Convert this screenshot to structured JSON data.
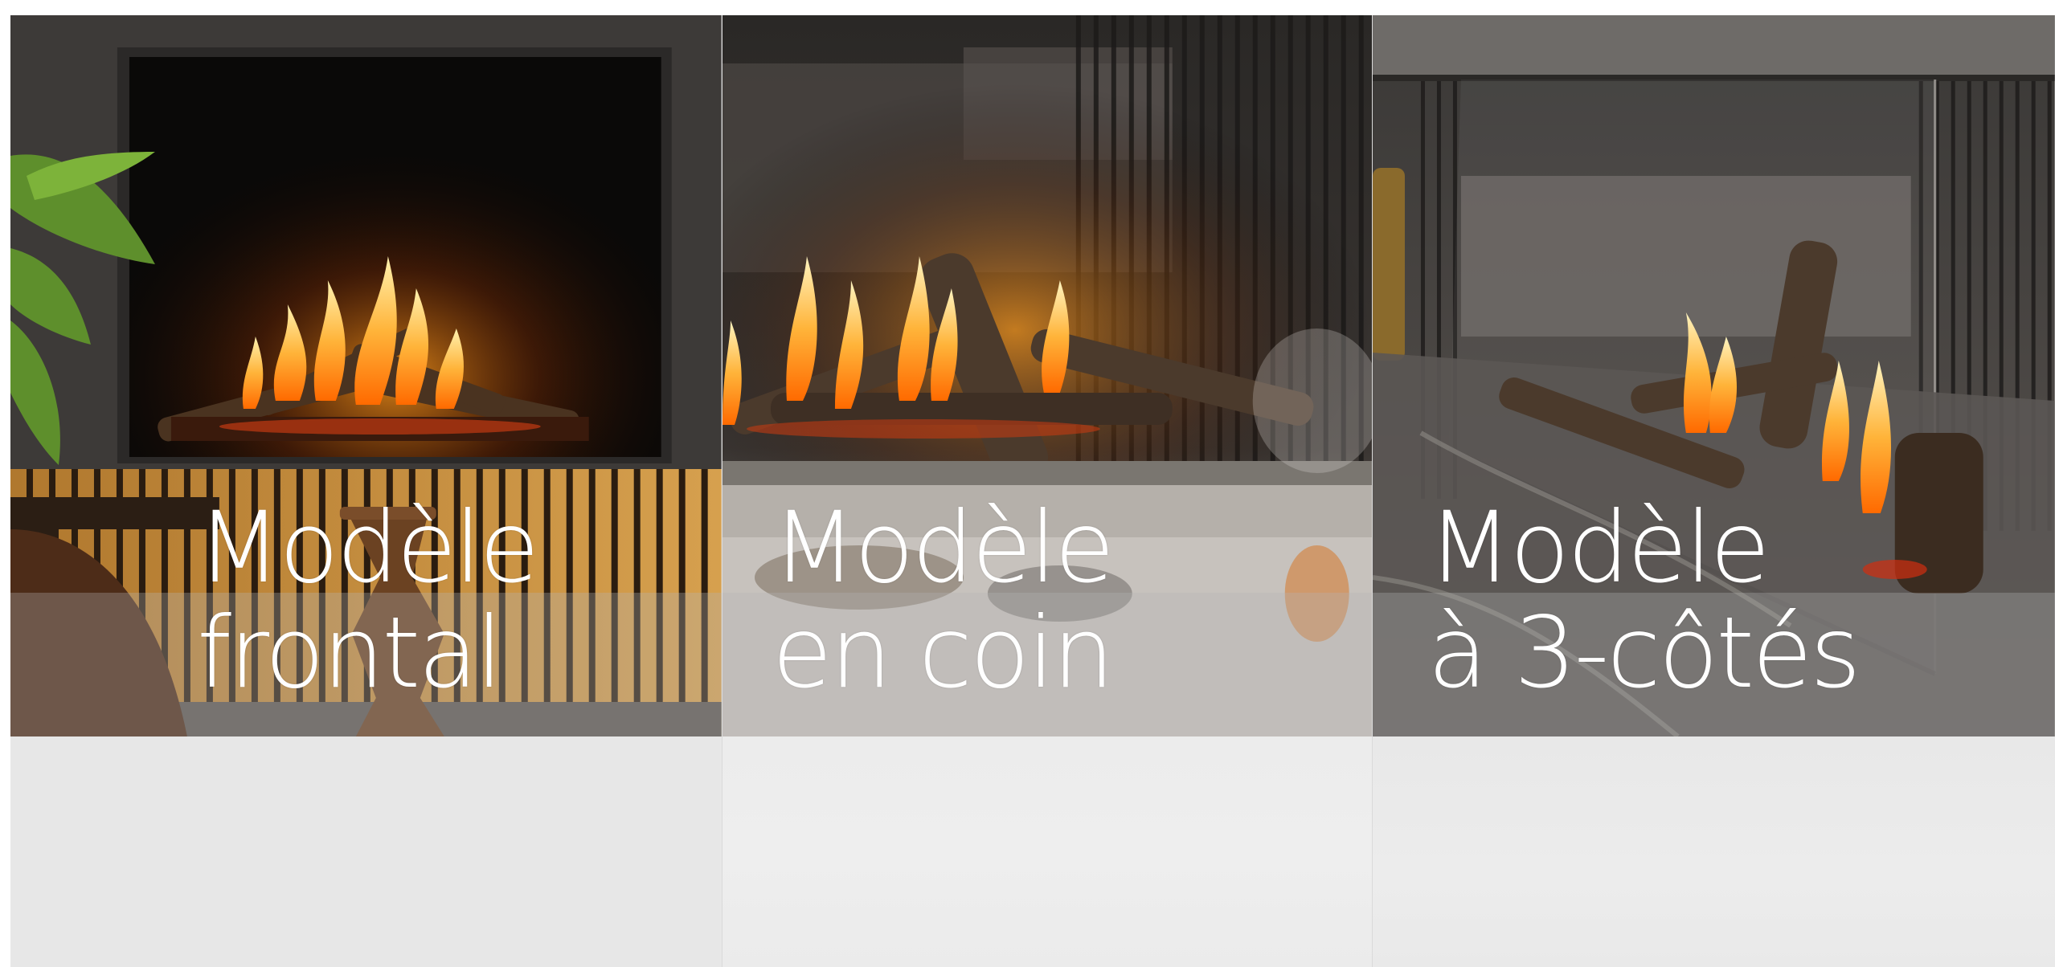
{
  "cards": [
    {
      "line1": "Modèle",
      "line2": "frontal",
      "image": "front-fireplace-photo"
    },
    {
      "line1": "Modèle",
      "line2": "en coin",
      "image": "corner-fireplace-photo"
    },
    {
      "line1": "Modèle",
      "line2": "à 3-côtés",
      "image": "three-sided-fireplace-photo"
    }
  ],
  "colors": {
    "title_text": "#ffffff",
    "lower_panel": "#e7e7e7",
    "flame": "#f5a623"
  }
}
